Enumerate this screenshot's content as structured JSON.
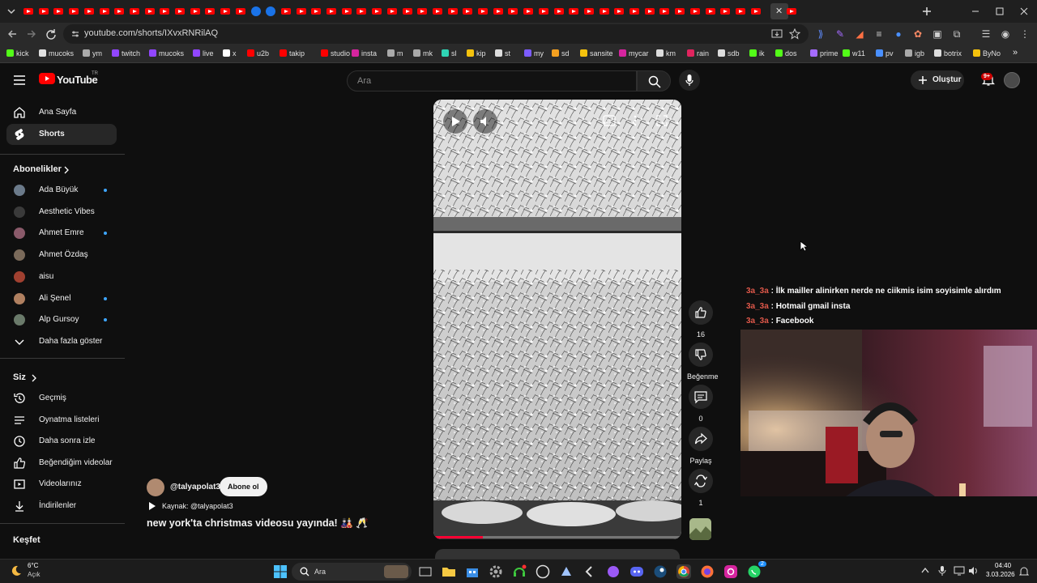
{
  "browser": {
    "url": "youtube.com/shorts/IXvxRNRilAQ",
    "bookmarks": [
      "kick",
      "mucoks",
      "ym",
      "twitch",
      "mucoks",
      "live",
      "x",
      "u2b",
      "takip",
      "studio",
      "insta",
      "m",
      "mk",
      "sl",
      "kip",
      "st",
      "my",
      "sd",
      "sansite",
      "mycar",
      "km",
      "rain",
      "sdb",
      "ik",
      "dos",
      "prime",
      "w11",
      "pv",
      "igb",
      "botrix",
      "ByNo"
    ]
  },
  "youtube": {
    "logo_text": "YouTube",
    "logo_region": "TR",
    "search_placeholder": "Ara",
    "create_label": "Oluştur",
    "notification_badge": "9+"
  },
  "sidebar": {
    "main": [
      {
        "label": "Ana Sayfa",
        "icon": "home-icon"
      },
      {
        "label": "Shorts",
        "icon": "shorts-icon"
      }
    ],
    "subscriptions_heading": "Abonelikler",
    "subscriptions": [
      {
        "label": "Ada Büyük",
        "dot": true,
        "color": "#6b7a8a"
      },
      {
        "label": "Aesthetic Vibes",
        "dot": false,
        "color": "#3a3a3a"
      },
      {
        "label": "Ahmet Emre",
        "dot": true,
        "color": "#8a5a6a"
      },
      {
        "label": "Ahmet Özdaş",
        "dot": false,
        "color": "#7a6a5a"
      },
      {
        "label": "aisu",
        "dot": false,
        "color": "#a04030"
      },
      {
        "label": "Ali Şenel",
        "dot": true,
        "color": "#b08060"
      },
      {
        "label": "Alp Gursoy",
        "dot": true,
        "color": "#6a7a6a"
      }
    ],
    "show_more": "Daha fazla göster",
    "you_heading": "Siz",
    "you": [
      {
        "label": "Geçmiş",
        "icon": "history-icon"
      },
      {
        "label": "Oynatma listeleri",
        "icon": "playlist-icon"
      },
      {
        "label": "Daha sonra izle",
        "icon": "clock-icon"
      },
      {
        "label": "Beğendiğim videolar",
        "icon": "thumbs-up-icon"
      },
      {
        "label": "Videolarınız",
        "icon": "video-icon"
      },
      {
        "label": "İndirilenler",
        "icon": "download-icon"
      }
    ],
    "explore_heading": "Keşfet"
  },
  "short": {
    "channel": "@talyapolat3",
    "subscribe_label": "Abone ol",
    "source_label": "Kaynak: @talyapolat3",
    "title": "new york'ta christmas videosu yayında! 🎎 🥂",
    "progress": 0.2,
    "actions": {
      "likes": "16",
      "dislike_label": "Beğenme",
      "comments": "0",
      "share_label": "Paylaş",
      "remix": "1"
    }
  },
  "chat": [
    {
      "user": "3a_3a",
      "text": "İlk mailler alinirken nerde ne ciikmis isim soyisimle alırdım"
    },
    {
      "user": "3a_3a",
      "text": "Hotmail gmail insta"
    },
    {
      "user": "3a_3a",
      "text": "Facebook"
    }
  ],
  "taskbar": {
    "weather_temp": "6°C",
    "weather_desc": "Açık",
    "search_label": "Ara",
    "time": "04:40",
    "date": "3.03.2026",
    "whatsapp_badge": "2"
  }
}
